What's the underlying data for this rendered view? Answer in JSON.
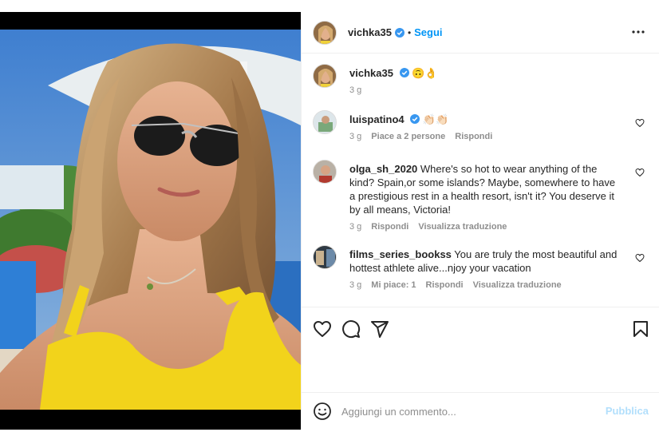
{
  "post": {
    "username": "vichka35",
    "follow_label": "Segui",
    "dot": "•",
    "caption_emojis": "🙃👌",
    "time": "3 g"
  },
  "comments": [
    {
      "user": "luispatino4",
      "text": "👏🏻👏🏻",
      "time": "3 g",
      "likes": "Piace a 2 persone",
      "reply": "Rispondi"
    },
    {
      "user": "olga_sh_2020",
      "text": "Where's so hot to wear anything of the kind? Spain,or some islands? Maybe, somewhere to have a prestigious rest in a health resort, isn't it? You deserve it by all means, Victoria!",
      "time": "3 g",
      "reply": "Rispondi",
      "translate": "Visualizza traduzione"
    },
    {
      "user": "films_series_bookss",
      "text": "You are truly the most beautiful and hottest athlete alive...njoy your vacation",
      "time": "3 g",
      "likes": "Mi piace: 1",
      "reply": "Rispondi",
      "translate": "Visualizza traduzione"
    }
  ],
  "composer": {
    "placeholder": "Aggiungi un commento...",
    "publish_label": "Pubblica"
  },
  "icons": {
    "verified": "verified-badge-icon",
    "more": "more-options-icon",
    "heart": "heart-icon",
    "comment": "comment-icon",
    "share": "share-icon",
    "save": "bookmark-icon",
    "emoji": "emoji-icon"
  },
  "colors": {
    "accent": "#0095f6",
    "publish_disabled": "#b2dffc",
    "muted": "#8e8e8e",
    "text": "#262626"
  }
}
